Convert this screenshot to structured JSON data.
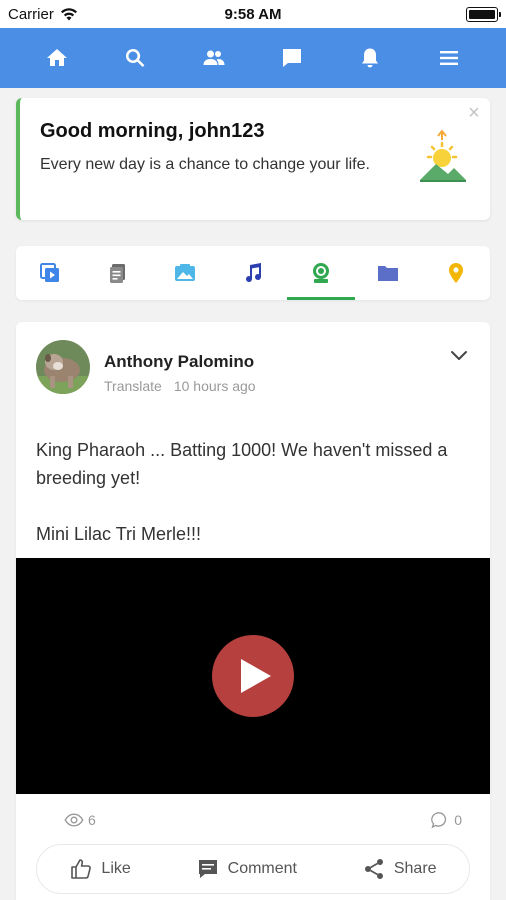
{
  "status_bar": {
    "carrier": "Carrier",
    "time": "9:58 AM"
  },
  "nav": {
    "items": [
      "home-icon",
      "search-icon",
      "friends-icon",
      "messages-icon",
      "notifications-icon",
      "menu-icon"
    ],
    "color": "#4a8ee6"
  },
  "greeting": {
    "title": "Good morning, john123",
    "message": "Every new day is a chance to change your life.",
    "accent": "#5cb85c"
  },
  "tabs": {
    "items": [
      "video-icon",
      "document-icon",
      "photo-icon",
      "music-icon",
      "webcam-icon",
      "folder-icon",
      "location-icon"
    ],
    "active_index": 4,
    "active_color": "#2fa84f"
  },
  "post": {
    "author": "Anthony Palomino",
    "translate_label": "Translate",
    "time_ago": "10 hours ago",
    "text_line1": "King Pharaoh ... Batting 1000! We haven't missed a breeding yet!",
    "text_line2": "Mini Lilac Tri Merle!!!",
    "views": "6",
    "comments": "0",
    "play_color": "#b5403e"
  },
  "actions": {
    "like": "Like",
    "comment": "Comment",
    "share": "Share"
  }
}
